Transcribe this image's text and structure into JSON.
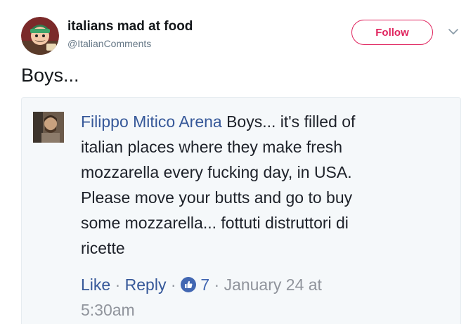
{
  "tweet": {
    "author_name": "italians mad at food",
    "author_handle": "@ItalianComments",
    "follow_label": "Follow",
    "text": "Boys..."
  },
  "embedded_comment": {
    "commenter_name": "Filippo Mitico Arena",
    "text_lines": [
      " Boys... it's filled of",
      "italian places where they make fresh",
      "mozzarella every fucking day, in USA.",
      "Please move your butts and go to buy",
      "some mozzarella... fottuti distruttori di",
      "ricette"
    ],
    "like_label": "Like",
    "separator": " · ",
    "reply_label": "Reply",
    "reaction_count": "7",
    "timestamp_line1": "January 24 at",
    "timestamp_line2": "5:30am"
  },
  "colors": {
    "follow_accent": "#e0245e",
    "facebook_link": "#365899",
    "facebook_like": "#4267b2",
    "card_background": "#f5f8fa"
  },
  "icons": {
    "avatar": "cartoon-avatar",
    "caret": "chevron-down-icon",
    "like": "thumbs-up-icon"
  }
}
